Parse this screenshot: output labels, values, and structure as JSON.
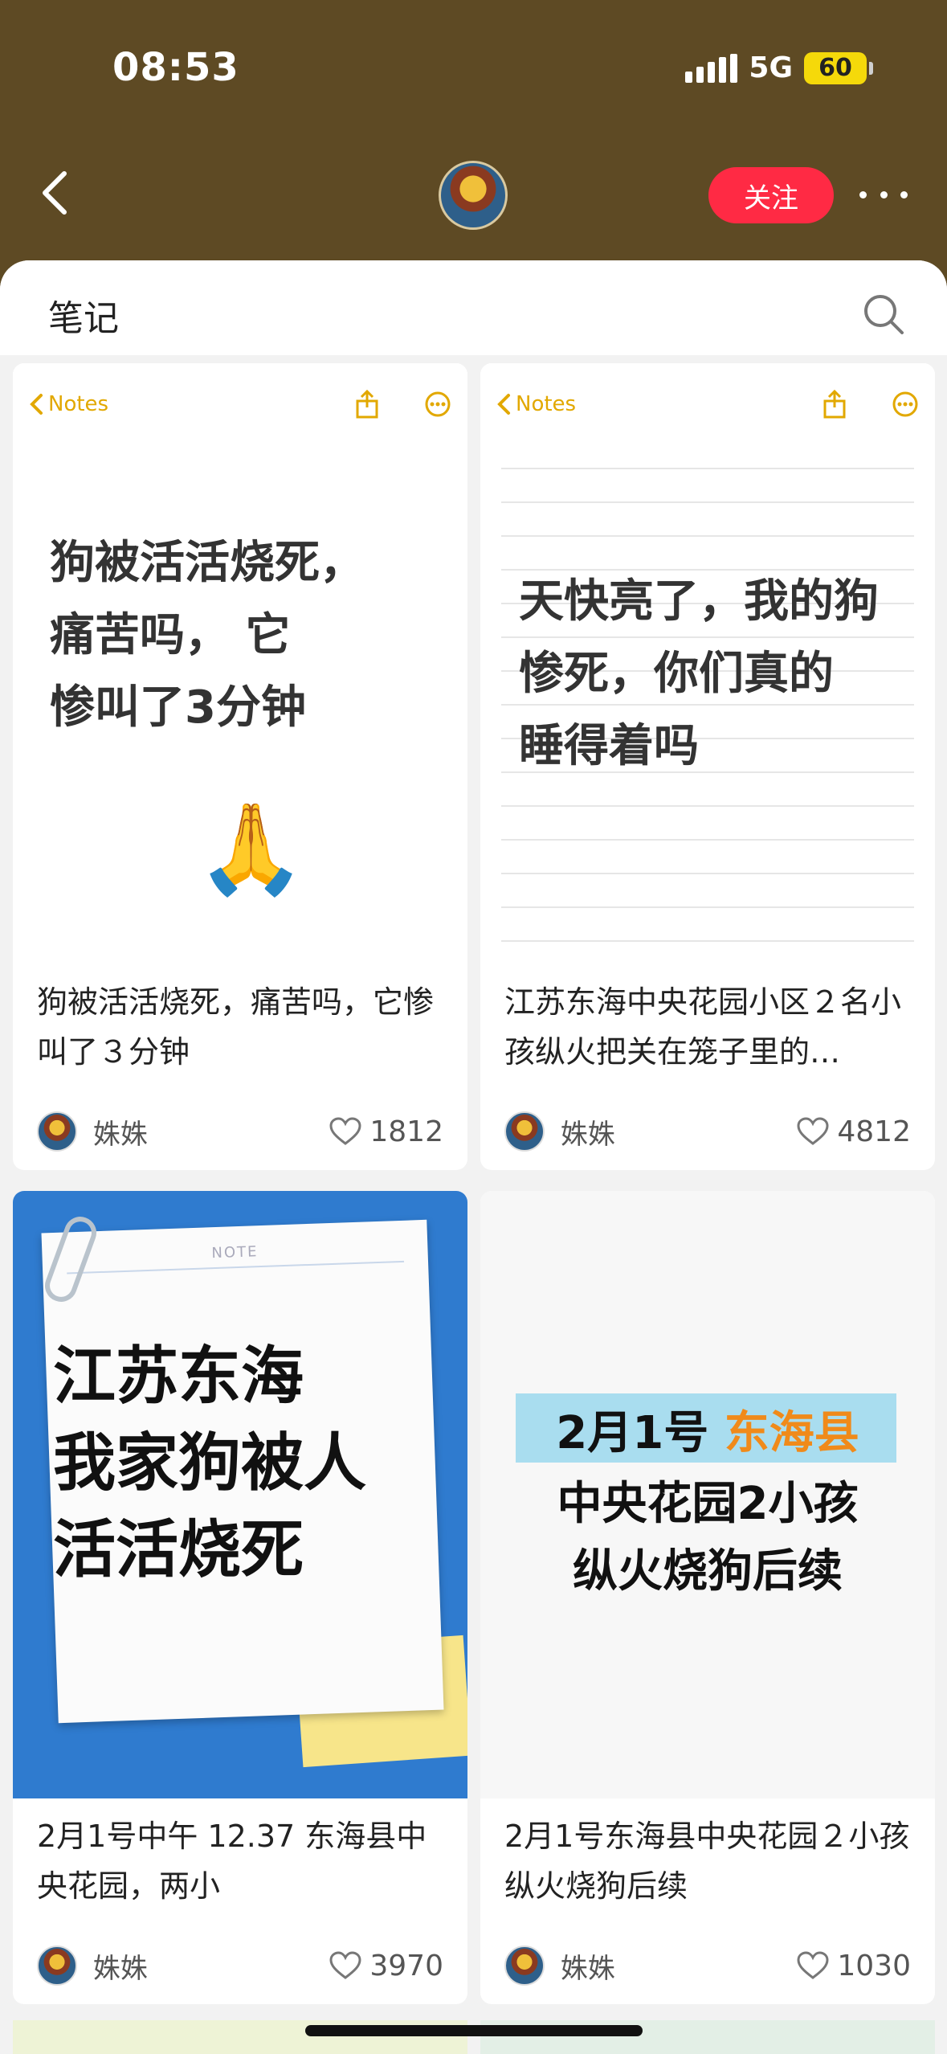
{
  "status": {
    "time": "08:53",
    "network": "5G",
    "battery": "60"
  },
  "header": {
    "follow_label": "关注"
  },
  "section": {
    "title": "笔记"
  },
  "colors": {
    "header_bg": "#5e4a24",
    "accent": "#ff2a44",
    "notes_yellow": "#e2a800"
  },
  "cards": [
    {
      "cover": {
        "app_back": "Notes",
        "lines": [
          "狗被活活烧死，",
          "痛苦吗， 它",
          "惨叫了3分钟"
        ],
        "emoji": "🙏"
      },
      "caption": "狗被活活烧死，痛苦吗，它惨叫了３分钟",
      "author": "姝姝",
      "likes": "1812"
    },
    {
      "cover": {
        "app_back": "Notes",
        "lines": [
          "天快亮了，我的狗",
          "惨死，你们真的",
          "睡得着吗"
        ]
      },
      "caption": "江苏东海中央花园小区２名小孩纵火把关在笼子里的…",
      "author": "姝姝",
      "likes": "4812"
    },
    {
      "cover": {
        "note_label": "NOTE",
        "lines": [
          "江苏东海",
          "我家狗被人",
          "活活烧死"
        ]
      },
      "caption": "2月1号中午 12.37 东海县中央花园，两小",
      "author": "姝姝",
      "likes": "3970"
    },
    {
      "cover": {
        "line1_a": "2月1号 ",
        "line1_b": "东海县",
        "line2": "中央花园2小孩",
        "line3": "纵火烧狗后续"
      },
      "caption": "2月1号东海县中央花园２小孩纵火烧狗后续",
      "author": "姝姝",
      "likes": "1030"
    }
  ]
}
